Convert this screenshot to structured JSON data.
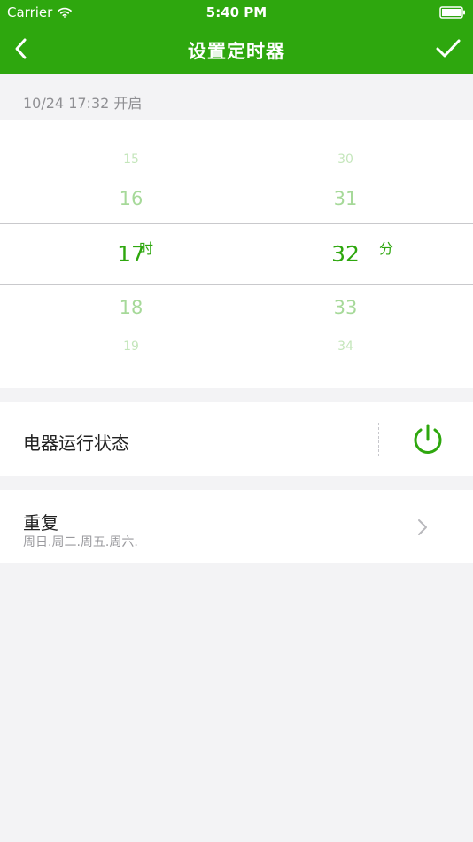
{
  "status_bar": {
    "carrier": "Carrier",
    "time": "5:40 PM"
  },
  "nav": {
    "title": "设置定时器"
  },
  "summary": {
    "text": "10/24 17:32 开启"
  },
  "time_picker": {
    "hour_unit": "时",
    "minute_unit": "分",
    "hours": [
      "15",
      "16",
      "17",
      "18",
      "19"
    ],
    "minutes": [
      "30",
      "31",
      "32",
      "33",
      "34"
    ],
    "selected_hour": "17",
    "selected_minute": "32"
  },
  "device_state": {
    "label": "电器运行状态"
  },
  "repeat": {
    "title": "重复",
    "days": "周日.周二.周五.周六."
  },
  "colors": {
    "primary": "#2ea70e",
    "background": "#f3f3f5",
    "text": "#222222",
    "muted": "#8f8f93"
  },
  "icons": {
    "back": "chevron-left-icon",
    "confirm": "check-icon",
    "power": "power-icon",
    "next": "chevron-right-icon"
  }
}
